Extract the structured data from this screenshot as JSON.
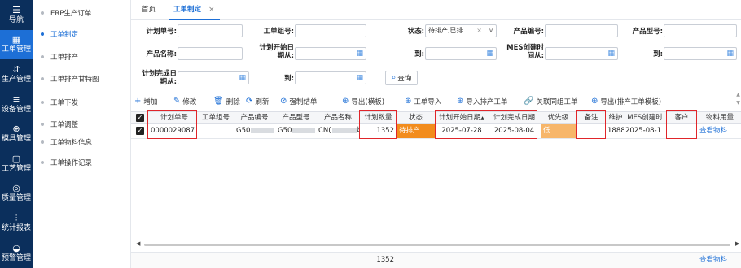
{
  "nav": [
    {
      "icon": "☰",
      "label": "导航"
    },
    {
      "icon": "▦",
      "label": "工单管理",
      "active": true
    },
    {
      "icon": "⇵",
      "label": "生产管理"
    },
    {
      "icon": "≡",
      "label": "设备管理"
    },
    {
      "icon": "⊕",
      "label": "模具管理"
    },
    {
      "icon": "▢",
      "label": "工艺管理"
    },
    {
      "icon": "◎",
      "label": "质量管理"
    },
    {
      "icon": "⫶",
      "label": "统计报表"
    },
    {
      "icon": "◒",
      "label": "预警管理"
    }
  ],
  "subnav": [
    {
      "label": "ERP生产订单"
    },
    {
      "label": "工单制定",
      "active": true
    },
    {
      "label": "工单排产"
    },
    {
      "label": "工单排产甘特图"
    },
    {
      "label": "工单下发"
    },
    {
      "label": "工单调整"
    },
    {
      "label": "工单物料信息"
    },
    {
      "label": "工单操作记录"
    }
  ],
  "tabs": {
    "home": "首页",
    "active": "工单制定",
    "close": "×"
  },
  "filters": {
    "plan_no": "计划单号:",
    "group_no": "工单组号:",
    "status": "状态:",
    "status_value": "待排产,已排",
    "status_clear": "×",
    "product_code": "产品编号:",
    "product_model": "产品型号:",
    "product_name": "产品名称:",
    "plan_start_line1": "计划开始日",
    "plan_start_line2": "期从:",
    "to": "到:",
    "mes_created_line1": "MES创建时",
    "mes_created_line2": "间从:",
    "plan_done_line1": "计划完成日",
    "plan_done_line2": "期从:",
    "query_label": "查询"
  },
  "toolbar": [
    {
      "icon": "+",
      "label": "增加",
      "name": "add-button",
      "ic": "plus-icon"
    },
    {
      "icon": "✎",
      "label": "修改",
      "name": "edit-button",
      "ic": "pencil-icon"
    },
    {
      "icon": "🗑",
      "label": "删除",
      "name": "delete-button",
      "ic": "trash-icon"
    },
    {
      "icon": "⟳",
      "label": "刷新",
      "name": "refresh-button",
      "ic": "refresh-icon"
    },
    {
      "icon": "⊘",
      "label": "强制结单",
      "name": "force-close-button",
      "ic": "forbid-icon"
    },
    {
      "icon": "⊕",
      "label": "导出(横板)",
      "name": "export-template-button",
      "ic": "export-icon"
    },
    {
      "icon": "⊕",
      "label": "工单导入",
      "name": "import-workorder-button",
      "ic": "import-icon"
    },
    {
      "icon": "⊕",
      "label": "导入排产工单",
      "name": "import-schedule-button",
      "ic": "import-icon"
    },
    {
      "icon": "🔗",
      "label": "关联同组工单",
      "name": "link-group-button",
      "ic": "link-icon"
    },
    {
      "icon": "⊕",
      "label": "导出(排产工单模板)",
      "name": "export-schedule-template-button",
      "ic": "export-icon"
    }
  ],
  "table": {
    "headers": [
      "计划单号",
      "工单组号",
      "产品编号",
      "产品型号",
      "产品名称",
      "计划数量",
      "状态",
      "计划开始日期",
      "计划完成日期",
      "优先级",
      "备注",
      "维护",
      "MES创建时",
      "客户",
      "物料用量"
    ],
    "sort_indicator": "▲",
    "row": {
      "plan_no": "0000029087",
      "group_no": "",
      "product_code": "G50",
      "product_model": "G50",
      "product_name": "CN(",
      "name_tail": "灯",
      "qty": "1352",
      "status": "待排产",
      "start": "2025-07-28",
      "end": "2025-08-04",
      "priority": "低",
      "remark": "",
      "maint": "1888",
      "mes_created": "2025-08-1",
      "customer": "",
      "material": "查看物料"
    }
  },
  "footer": {
    "total_qty": "1352",
    "material": "查看物料"
  },
  "colors": {
    "nav_bg": "#0b2f5c",
    "accent": "#1d6fd6",
    "status_bg": "#f28c1d",
    "highlight": "#e0252a"
  }
}
